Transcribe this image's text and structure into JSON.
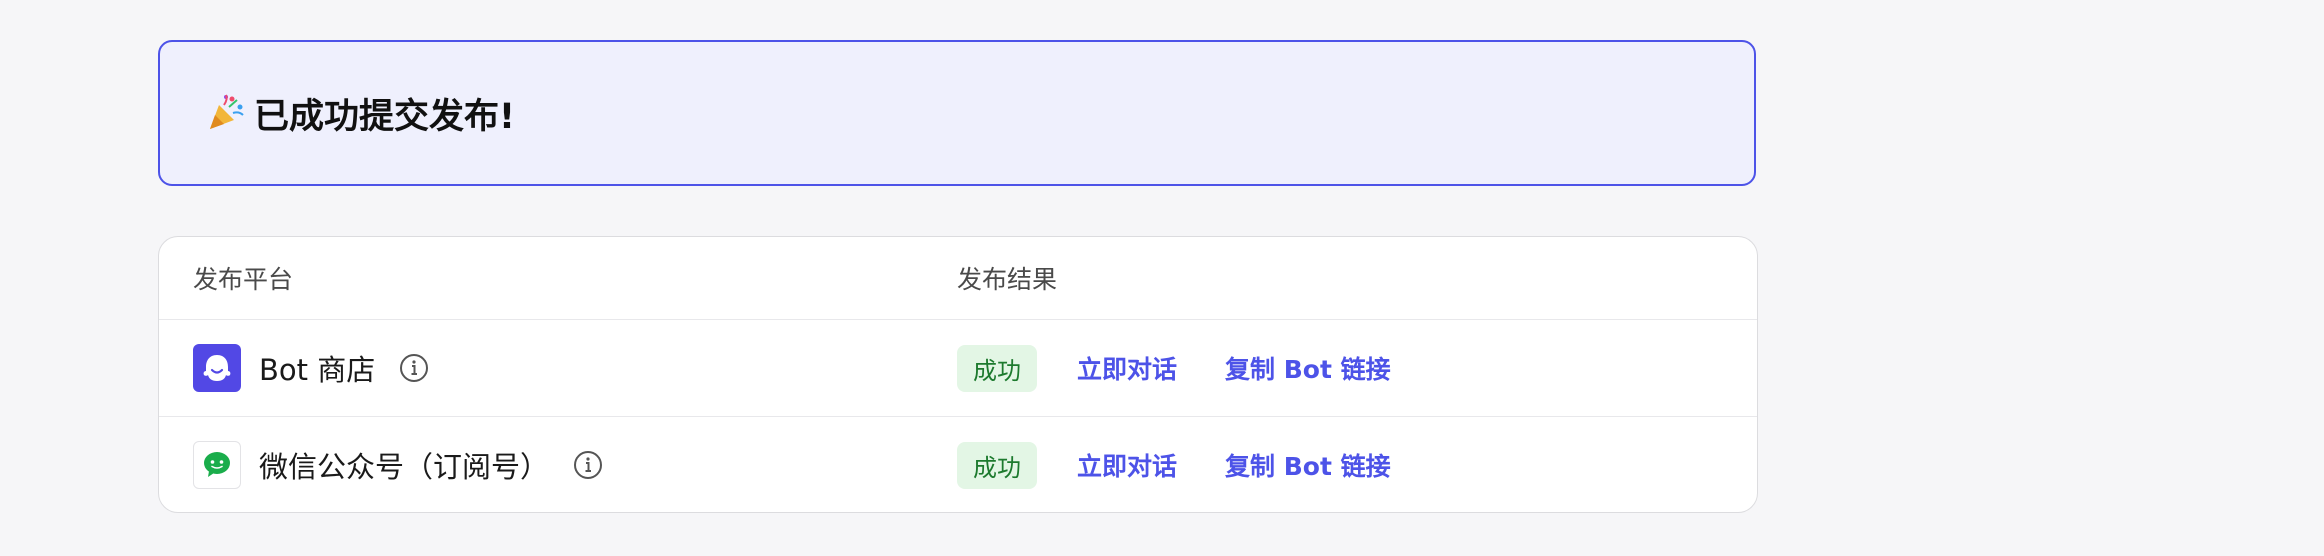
{
  "banner": {
    "title": "已成功提交发布!"
  },
  "table": {
    "headers": {
      "platform": "发布平台",
      "result": "发布结果"
    },
    "rows": [
      {
        "platform": "Bot 商店",
        "logo_icon": "bot-store-icon",
        "status": "成功",
        "action_chat": "立即对话",
        "action_copy": "复制 Bot 链接"
      },
      {
        "platform": "微信公众号（订阅号）",
        "logo_icon": "wechat-icon",
        "status": "成功",
        "action_chat": "立即对话",
        "action_copy": "复制 Bot 链接"
      }
    ]
  },
  "colors": {
    "accent": "#4d53e8",
    "banner_bg": "#eff0fd",
    "success_bg": "#e3f6e5",
    "success_text": "#1d7a2e",
    "bot_logo_bg": "#5248e5",
    "wechat_green": "#1aad4b"
  }
}
